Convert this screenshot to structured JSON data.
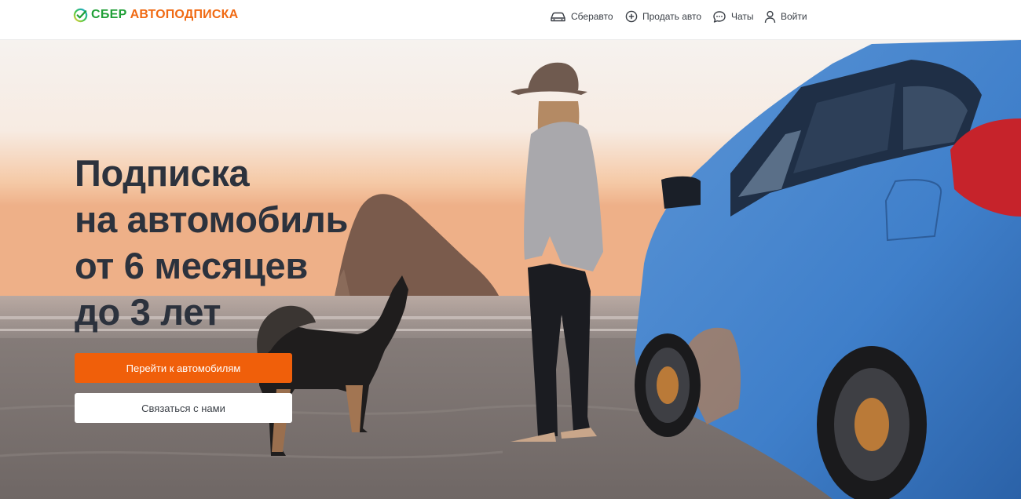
{
  "brand": {
    "name_primary": "СБЕР",
    "name_secondary": "АВТОПОДПИСКА",
    "colors": {
      "green": "#21a038",
      "orange": "#f06a13"
    }
  },
  "nav": {
    "items": [
      {
        "label": "Сберавто",
        "icon": "car-icon"
      },
      {
        "label": "Продать авто",
        "icon": "plus-circle-icon"
      },
      {
        "label": "Чаты",
        "icon": "chat-icon"
      },
      {
        "label": "Войти",
        "icon": "user-icon"
      }
    ]
  },
  "hero": {
    "headline_lines": [
      "Подписка",
      "на автомобиль",
      "от 6 месяцев",
      "до 3 лет"
    ],
    "primary_button": "Перейти к автомобилям",
    "secondary_button": "Связаться с нами",
    "accent_color": "#f05f0a"
  }
}
